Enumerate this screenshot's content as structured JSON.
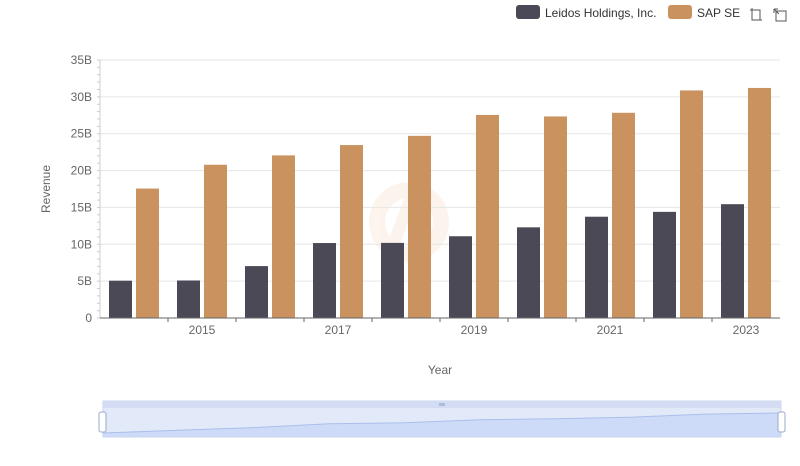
{
  "chart_data": {
    "type": "bar",
    "categories": [
      "2014",
      "2015",
      "2016",
      "2017",
      "2018",
      "2019",
      "2020",
      "2021",
      "2022",
      "2023"
    ],
    "series": [
      {
        "name": "Leidos Holdings, Inc.",
        "color": "#4a4955",
        "values": [
          5.06,
          5.09,
          7.04,
          10.17,
          10.19,
          11.09,
          12.3,
          13.74,
          14.4,
          15.44
        ]
      },
      {
        "name": "SAP SE",
        "color": "#c9925f",
        "values": [
          17.56,
          20.79,
          22.06,
          23.46,
          24.71,
          27.55,
          27.34,
          27.84,
          30.87,
          31.21
        ]
      }
    ],
    "ylabel": "Revenue",
    "xlabel": "Year",
    "ylim": [
      0,
      35
    ],
    "yticks": [
      {
        "value": 0,
        "label": "0"
      },
      {
        "value": 5,
        "label": "5B"
      },
      {
        "value": 10,
        "label": "10B"
      },
      {
        "value": 15,
        "label": "15B"
      },
      {
        "value": 20,
        "label": "20B"
      },
      {
        "value": 25,
        "label": "25B"
      },
      {
        "value": 30,
        "label": "30B"
      },
      {
        "value": 35,
        "label": "35B"
      }
    ],
    "xtick_labels": [
      "2015",
      "2017",
      "2019",
      "2021",
      "2023"
    ],
    "grid": true,
    "legend_position": "top-right"
  },
  "toolbar": {
    "zoom_icon": "zoom-select-icon",
    "reset_icon": "zoom-reset-icon"
  },
  "slider": {
    "grip_icon": "drag-grip-icon",
    "fill": "#d6e2fb",
    "border": "#c9d5ee"
  }
}
